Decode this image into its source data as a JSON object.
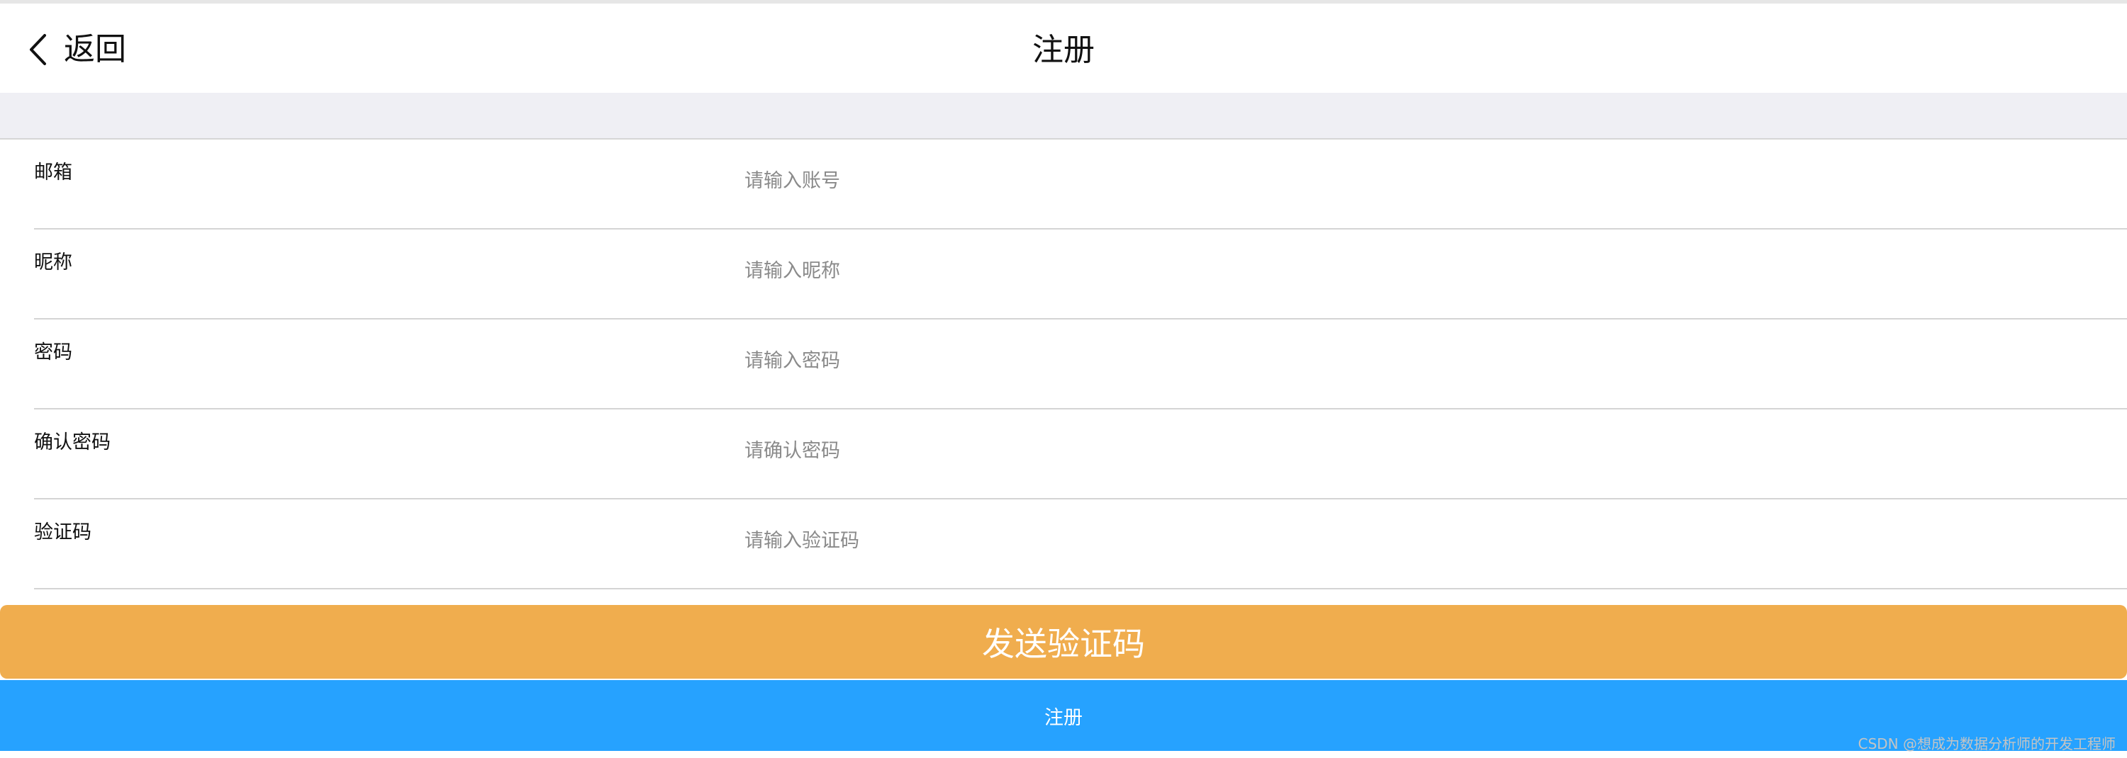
{
  "navbar": {
    "back_label": "返回",
    "title": "注册"
  },
  "form": {
    "fields": [
      {
        "label": "邮箱",
        "placeholder": "请输入账号"
      },
      {
        "label": "昵称",
        "placeholder": "请输入昵称"
      },
      {
        "label": "密码",
        "placeholder": "请输入密码"
      },
      {
        "label": "确认密码",
        "placeholder": "请确认密码"
      },
      {
        "label": "验证码",
        "placeholder": "请输入验证码"
      }
    ]
  },
  "buttons": {
    "send_code_label": "发送验证码",
    "register_label": "注册"
  },
  "watermark": "CSDN @想成为数据分析师的开发工程师",
  "colors": {
    "send_code": "#f0ad4e",
    "register": "#26a2ff",
    "gap_band": "#efeff4"
  },
  "icons": {
    "back": "chevron-left-icon"
  }
}
